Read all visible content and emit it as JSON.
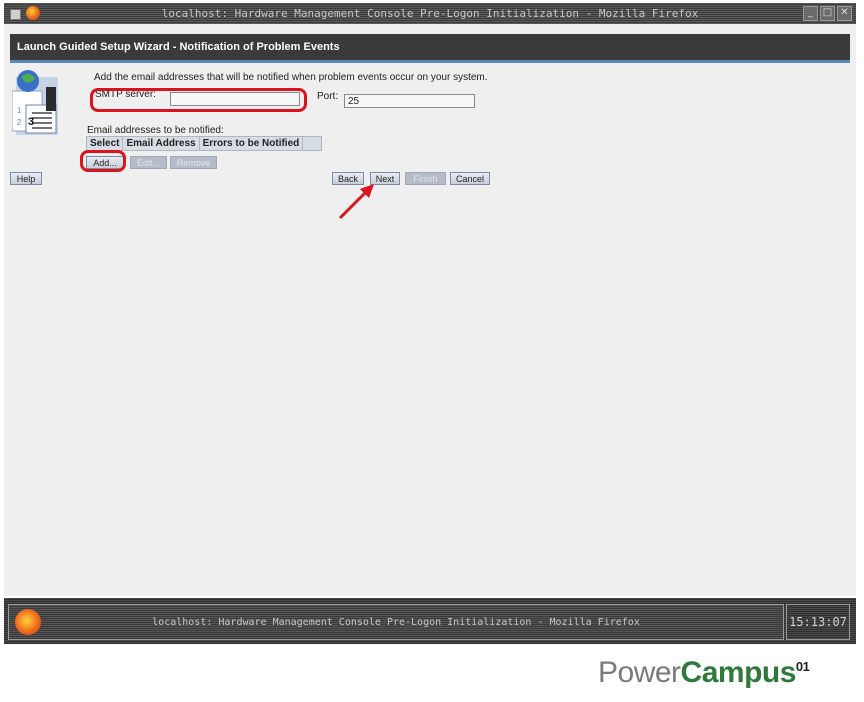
{
  "window": {
    "title": "localhost: Hardware Management Console Pre-Logon Initialization - Mozilla Firefox",
    "controls": [
      "minimize",
      "maximize",
      "close"
    ]
  },
  "wizard": {
    "header": "Launch Guided Setup Wizard - Notification of Problem Events",
    "description": "Add the email addresses that will be notified when problem events occur on your system.",
    "smtp": {
      "label": "SMTP server:",
      "value": ""
    },
    "port": {
      "label": "Port:",
      "value": "25"
    },
    "emails": {
      "label": "Email addresses to be notified:",
      "columns": [
        "Select",
        "Email Address",
        "Errors to be Notified"
      ]
    },
    "buttons": {
      "add": "Add...",
      "edit": "Edit...",
      "remove": "Remove",
      "help": "Help",
      "back": "Back",
      "next": "Next",
      "finish": "Finish",
      "cancel": "Cancel"
    },
    "highlight_color": "#d9141c"
  },
  "taskbar": {
    "task_title": "localhost: Hardware Management Console Pre-Logon Initialization - Mozilla Firefox",
    "clock": "15:13:07"
  },
  "brand": {
    "part1": "Power",
    "part2": "Campus",
    "sup": "01"
  }
}
